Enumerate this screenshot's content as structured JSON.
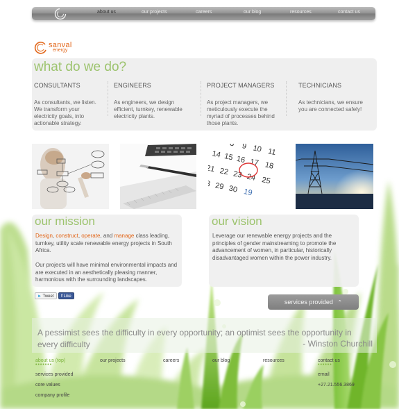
{
  "nav": {
    "items": [
      "about us",
      "our projects",
      "careers",
      "our blog",
      "resources",
      "contact us"
    ],
    "active": "about us"
  },
  "brand": {
    "name": "sanval",
    "sub": "energy"
  },
  "what": {
    "title": "what do we do?",
    "roles": [
      {
        "title": "CONSULTANTS",
        "desc": "As consultants, we listen. We transform your electricity goals, into actionable strategy."
      },
      {
        "title": "ENGINEERS",
        "desc": "As engineers, we design efficient, turnkey, renewable electricity plants."
      },
      {
        "title": "PROJECT MANAGERS",
        "desc": "As project managers, we meticulously execute the myriad of processes behind those plants."
      },
      {
        "title": "TECHNICIANS",
        "desc": "As technicians, we ensure you are connected safely!"
      }
    ]
  },
  "photos": [
    "flowchart-photo",
    "calculator-photo",
    "calendar-photo",
    "power-pylon-photo"
  ],
  "mission": {
    "title": "our mission",
    "w1": "Design",
    "s1": ", ",
    "w2": "construct",
    "s2": ", ",
    "w3": "operate",
    "s3": ", and ",
    "w4": "manage",
    "rest": " class leading, turnkey, utility scale renewable energy projects in South Africa.",
    "p2": "Our projects will have minimal environmental impacts and are executed in an aesthetically pleasing manner, harmonious with the surrounding landscapes."
  },
  "vision": {
    "title": "our vision",
    "text": "Leverage our renewable energy projects and the principles of gender mainstreaming to promote the advancement of women, in particular, historically disadvantaged women within the power industry."
  },
  "social": {
    "tweet": "Tweet",
    "like": "Like"
  },
  "services_button": "services provided",
  "quote": {
    "text": "A pessimist sees the difficulty in every opportunity; an optimist sees the opportunity in every difficulty",
    "author": "- Winston Churchill"
  },
  "footer": {
    "about_heading": "about us (top)",
    "about_links": [
      "services provided",
      "core values",
      "company profile"
    ],
    "columns": [
      "our projects",
      "careers",
      "our blog",
      "resources"
    ],
    "contact_heading": "contact us",
    "contact_items": [
      "email",
      "+27.21.556.3869"
    ]
  },
  "colors": {
    "accent": "#e2671b",
    "green": "#9cc36d",
    "nav": "#8f8f8f"
  }
}
